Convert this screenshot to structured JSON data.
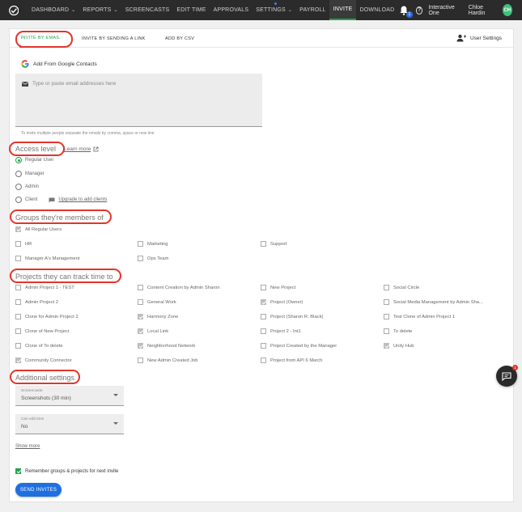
{
  "nav": {
    "items": [
      {
        "label": "DASHBOARD",
        "caret": true
      },
      {
        "label": "REPORTS",
        "caret": true
      },
      {
        "label": "SCREENCASTS",
        "caret": false
      },
      {
        "label": "EDIT TIME",
        "caret": false
      },
      {
        "label": "APPROVALS",
        "caret": false
      },
      {
        "label": "SETTINGS",
        "caret": true
      },
      {
        "label": "PAYROLL",
        "caret": false
      },
      {
        "label": "INVITE",
        "caret": false
      },
      {
        "label": "DOWNLOAD",
        "caret": false
      }
    ],
    "active": "INVITE",
    "notification_count": "1",
    "help_label": "?",
    "organization": "Interactive One",
    "user_name": "Chloe Hardin",
    "user_initials": "CH"
  },
  "tabs": {
    "items": [
      "INVITE BY EMAIL",
      "INVITE BY SENDING A LINK",
      "ADD BY CSV"
    ],
    "active": "INVITE BY EMAIL",
    "user_settings": "User Settings"
  },
  "email": {
    "google_button": "Add From Google Contacts",
    "placeholder": "Type or paste email addresses here",
    "hint": "To invite multiple people separate the emails by comma, space or new line"
  },
  "access": {
    "heading": "Access level",
    "learn_more": "Learn more",
    "options": [
      "Regular User",
      "Manager",
      "Admin",
      "Client"
    ],
    "selected": "Regular User",
    "upgrade": "Upgrade to add clients"
  },
  "groups": {
    "heading": "Groups they're members of",
    "items": [
      {
        "label": "All Regular Users",
        "checked": true
      },
      {
        "label": "HR",
        "checked": false
      },
      {
        "label": "Marketing",
        "checked": false
      },
      {
        "label": "Support",
        "checked": false
      },
      {
        "label": "Manager A's Management",
        "checked": false
      },
      {
        "label": "Ops Team",
        "checked": false
      }
    ]
  },
  "projects": {
    "heading": "Projects they can track time to",
    "items": [
      {
        "label": "Admin Project 1 - TEST",
        "checked": false
      },
      {
        "label": "Content Creation by Admin Sharon",
        "checked": false
      },
      {
        "label": "New Project",
        "checked": false
      },
      {
        "label": "Social Circle",
        "checked": false
      },
      {
        "label": "Admin Project 2",
        "checked": false
      },
      {
        "label": "General Work",
        "checked": false
      },
      {
        "label": "Project (Owner)",
        "checked": true
      },
      {
        "label": "Social Media Management by Admin Sha...",
        "checked": false
      },
      {
        "label": "Clone for Admin Project 2",
        "checked": false
      },
      {
        "label": "Harmony Zone",
        "checked": true
      },
      {
        "label": "Project (Sharon R. Black)",
        "checked": false
      },
      {
        "label": "Test Clone of Admin Project 1",
        "checked": false
      },
      {
        "label": "Clone of New Project",
        "checked": false
      },
      {
        "label": "Local Link",
        "checked": true
      },
      {
        "label": "Project 2 - Int1",
        "checked": false
      },
      {
        "label": "To delete",
        "checked": false
      },
      {
        "label": "Clone of To delete",
        "checked": false
      },
      {
        "label": "Neighborhood Network",
        "checked": true
      },
      {
        "label": "Project Created by the Manager",
        "checked": false
      },
      {
        "label": "Unity Hub",
        "checked": true
      },
      {
        "label": "Community Connector",
        "checked": true
      },
      {
        "label": "New Admin Created Job",
        "checked": false
      },
      {
        "label": "Project from API 6 March",
        "checked": false
      }
    ]
  },
  "additional": {
    "heading": "Additional settings",
    "screencasts_label": "Screencasts",
    "screencasts_value": "Screenshots (30 min)",
    "edit_time_label": "Can edit time",
    "edit_time_value": "No",
    "show_more": "Show more",
    "remember": "Remember groups & projects for next invite",
    "remember_checked": true
  },
  "send_button": "SEND INVITES",
  "chat_badge": "1",
  "colors": {
    "accent": "#1ea64c",
    "primary": "#1f6fe0",
    "highlight": "#e4342b",
    "nav_bg": "#2b2b2b"
  }
}
